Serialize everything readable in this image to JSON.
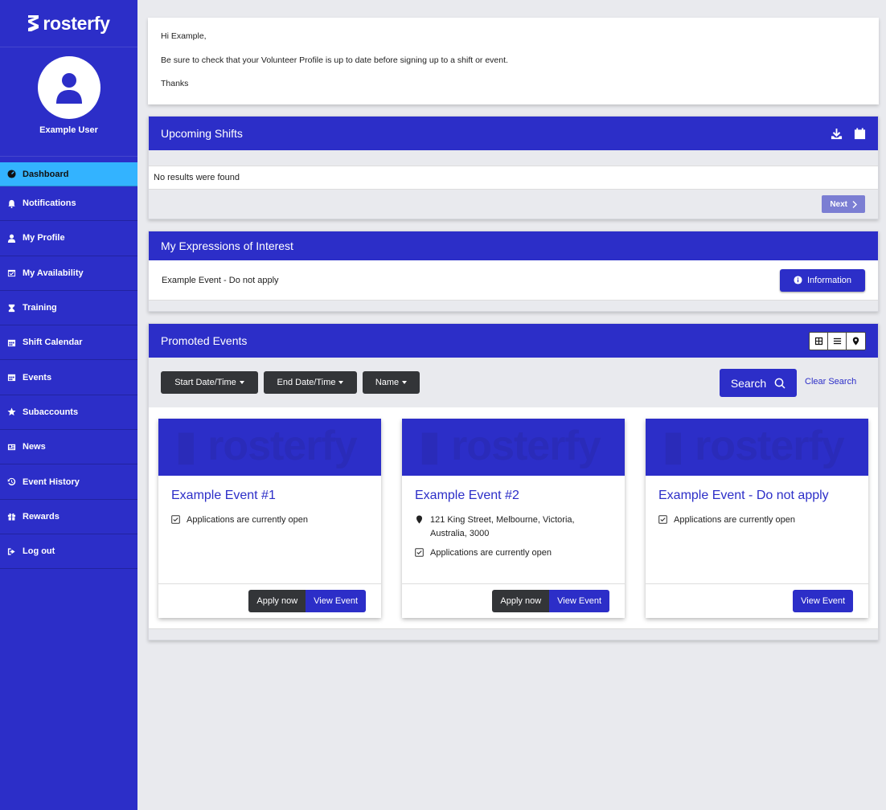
{
  "brand": {
    "name": "rosterfy"
  },
  "user": {
    "name": "Example User"
  },
  "nav": [
    {
      "label": "Dashboard",
      "icon": "dashboard-icon"
    },
    {
      "label": "Notifications",
      "icon": "bell-icon"
    },
    {
      "label": "My Profile",
      "icon": "user-icon"
    },
    {
      "label": "My Availability",
      "icon": "calendar-check-icon"
    },
    {
      "label": "Training",
      "icon": "hourglass-icon"
    },
    {
      "label": "Shift Calendar",
      "icon": "calendar-icon"
    },
    {
      "label": "Events",
      "icon": "calendar-icon"
    },
    {
      "label": "Subaccounts",
      "icon": "star-icon"
    },
    {
      "label": "News",
      "icon": "newspaper-icon"
    },
    {
      "label": "Event History",
      "icon": "history-icon"
    },
    {
      "label": "Rewards",
      "icon": "gift-icon"
    },
    {
      "label": "Log out",
      "icon": "logout-icon"
    }
  ],
  "welcome": {
    "greeting": "Hi Example,",
    "message": "Be sure to check that your Volunteer Profile is up to date before signing up to a shift or event.",
    "signoff": "Thanks"
  },
  "upcoming_shifts": {
    "title": "Upcoming Shifts",
    "empty_text": "No results were found",
    "next_label": "Next"
  },
  "eoi": {
    "title": "My Expressions of Interest",
    "item_name": "Example Event - Do not apply",
    "info_label": "Information"
  },
  "promoted": {
    "title": "Promoted Events",
    "filters": [
      "Start Date/Time",
      "End Date/Time",
      "Name"
    ],
    "search_label": "Search",
    "clear_label": "Clear Search",
    "events": [
      {
        "title": "Example Event #1",
        "address": "",
        "status": "Applications are currently open",
        "apply_label": "Apply now",
        "view_label": "View Event"
      },
      {
        "title": "Example Event #2",
        "address": "121 King Street, Melbourne, Victoria, Australia, 3000",
        "status": "Applications are currently open",
        "apply_label": "Apply now",
        "view_label": "View Event"
      },
      {
        "title": "Example Event - Do not apply",
        "address": "",
        "status": "Applications are currently open",
        "apply_label": "",
        "view_label": "View Event"
      }
    ]
  },
  "colors": {
    "primary": "#2c2ec8",
    "active_nav": "#33b3ff",
    "dark_button": "#333538",
    "background": "#e9eaee"
  }
}
